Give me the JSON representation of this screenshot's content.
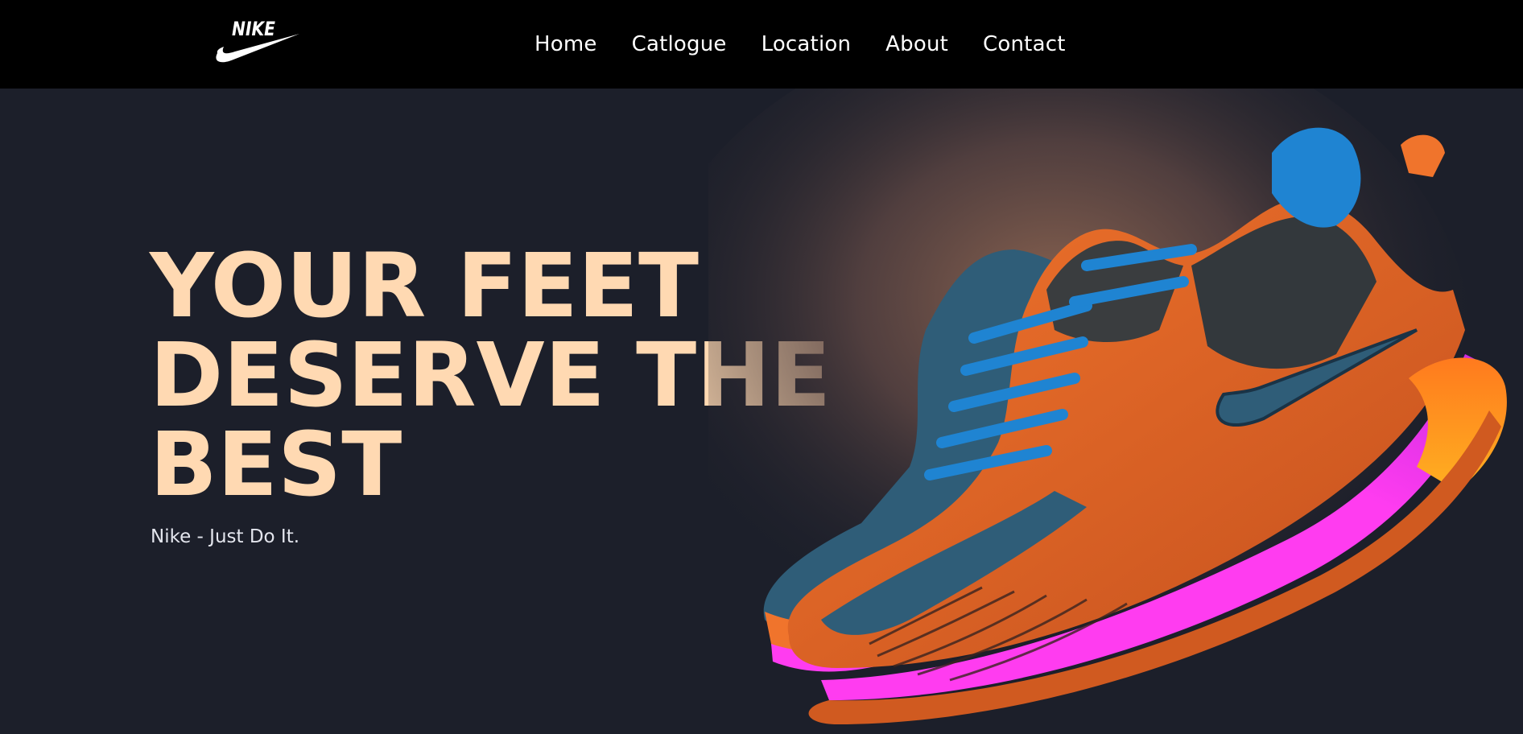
{
  "brand": {
    "logo_text": "NIKE",
    "logo_icon": "nike-swoosh-icon",
    "logo_color": "#ffffff"
  },
  "nav": {
    "items": [
      {
        "label": "Home"
      },
      {
        "label": "Catlogue"
      },
      {
        "label": "Location"
      },
      {
        "label": "About"
      },
      {
        "label": "Contact"
      }
    ],
    "background": "#000000",
    "text_color": "#ffffff"
  },
  "hero": {
    "title_lines": [
      "YOUR FEET",
      "DESERVE THE",
      "BEST"
    ],
    "tagline": "Nike - Just Do It.",
    "background": "#1c1f2a",
    "title_color": "#ffd9b2",
    "tagline_color": "#e4e6ee",
    "image": "sneaker-product-image",
    "image_colors": {
      "upper_orange": "#f0742c",
      "mesh_teal": "#2f5d78",
      "laces_blue": "#1f84d2",
      "sole_magenta": "#ff3cf0",
      "heel_yellow": "#ffb020",
      "glow": "#8a6350"
    }
  }
}
